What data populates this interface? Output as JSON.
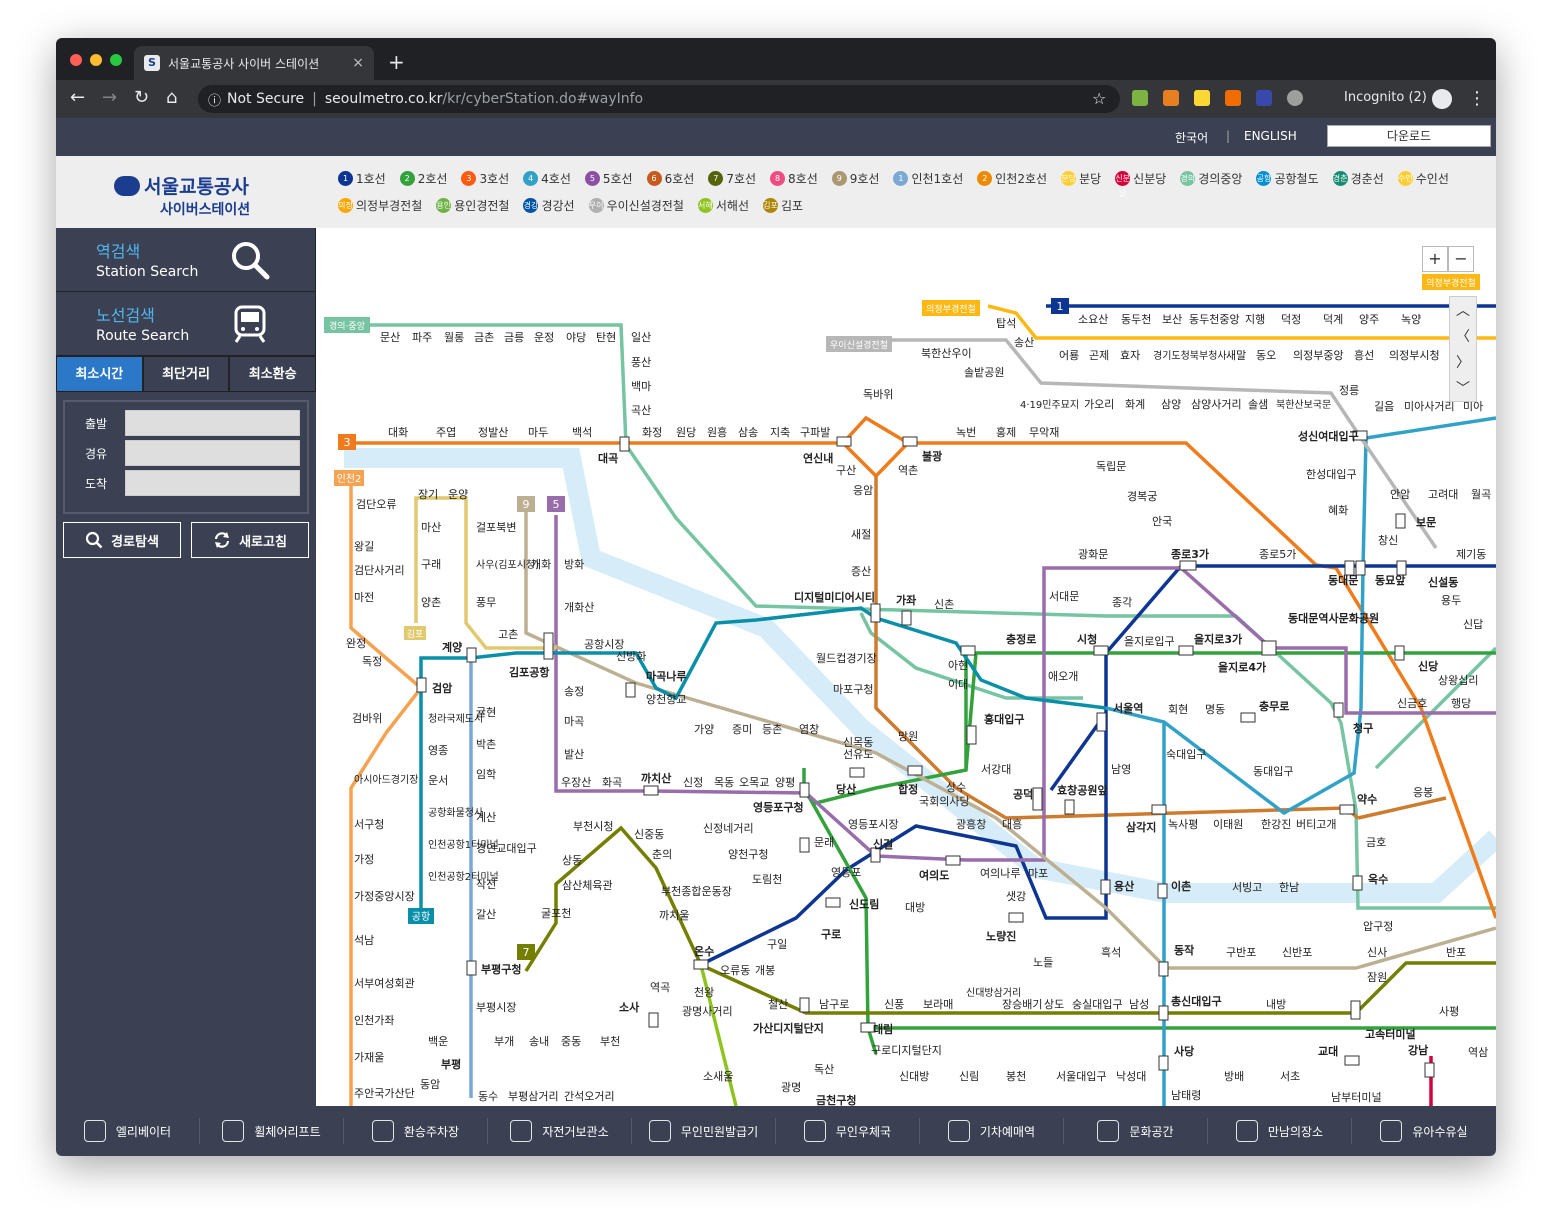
{
  "browser": {
    "tab_title": "서울교통공사 사이버 스테이션",
    "tab_close": "×",
    "new_tab": "+",
    "security": "Not Secure",
    "url_domain": "seoulmetro.co.kr",
    "url_path": "/kr/cyberStation.do#wayInfo",
    "incognito": "Incognito (2)"
  },
  "site": {
    "lang_ko": "한국어",
    "lang_en": "ENGLISH",
    "download": "다운로드",
    "logo_main": "서울교통공사",
    "logo_sub": "사이버스테이션"
  },
  "legend": [
    {
      "label": "1호선",
      "color": "#0d3692",
      "badge": "1"
    },
    {
      "label": "2호선",
      "color": "#33a23d",
      "badge": "2"
    },
    {
      "label": "3호선",
      "color": "#fe5b10",
      "badge": "3"
    },
    {
      "label": "4호선",
      "color": "#32a1c8",
      "badge": "4"
    },
    {
      "label": "5호선",
      "color": "#8b50a4",
      "badge": "5"
    },
    {
      "label": "6호선",
      "color": "#c55c1d",
      "badge": "6"
    },
    {
      "label": "7호선",
      "color": "#54640d",
      "badge": "7"
    },
    {
      "label": "8호선",
      "color": "#f14c82",
      "badge": "8"
    },
    {
      "label": "9호선",
      "color": "#aa9872",
      "badge": "9"
    },
    {
      "label": "인천1호선",
      "color": "#7ca8d5",
      "badge": "1"
    },
    {
      "label": "인천2호선",
      "color": "#ed8b00",
      "badge": "2"
    },
    {
      "label": "분당",
      "color": "#ffce33",
      "badge": "분당"
    },
    {
      "label": "신분당",
      "color": "#d4003b",
      "badge": "신분당"
    },
    {
      "label": "경의중앙",
      "color": "#77c4a3",
      "badge": "경의"
    },
    {
      "label": "공항철도",
      "color": "#0090d2",
      "badge": "공항"
    },
    {
      "label": "경춘선",
      "color": "#178c72",
      "badge": "경춘"
    },
    {
      "label": "수인선",
      "color": "#ffce33",
      "badge": "수인"
    },
    {
      "label": "의정부경전철",
      "color": "#fda600",
      "badge": "의정"
    },
    {
      "label": "용인경전철",
      "color": "#6fb245",
      "badge": "용인"
    },
    {
      "label": "경강선",
      "color": "#0054a6",
      "badge": "경강"
    },
    {
      "label": "우이신설경전철",
      "color": "#b0b0b0",
      "badge": "우이"
    },
    {
      "label": "서해선",
      "color": "#8fc31f",
      "badge": "서해"
    },
    {
      "label": "김포",
      "color": "#ad8605",
      "badge": "김포"
    }
  ],
  "sidebar": {
    "station_search_ko": "역검색",
    "station_search_en": "Station Search",
    "route_search_ko": "노선검색",
    "route_search_en": "Route Search",
    "tabs": [
      "최소시간",
      "최단거리",
      "최소환승"
    ],
    "departure": "출발",
    "via": "경유",
    "arrival": "도착",
    "search_btn": "경로탐색",
    "refresh_btn": "새로고침"
  },
  "map": {
    "zoom_in": "+",
    "zoom_out": "−",
    "line_badges": {
      "l1": "1",
      "l3": "3",
      "l5": "5",
      "l7": "7",
      "l9": "9",
      "incheon2": "인천2",
      "gyeongui": "경의·중앙",
      "ui": "우이신설경전철",
      "uijeongbu": "의정부경전철",
      "uijeongbu2": "의정부경전철",
      "gimpo": "김포",
      "airport": "공항"
    },
    "stations": {
      "s01": "문산",
      "s02": "파주",
      "s03": "월롱",
      "s04": "금촌",
      "s05": "금릉",
      "s06": "운정",
      "s07": "야당",
      "s08": "탄현",
      "s09": "일산",
      "s10": "풍산",
      "s11": "백마",
      "s12": "곡산",
      "s13": "대화",
      "s14": "주엽",
      "s15": "정발산",
      "s16": "마두",
      "s17": "백석",
      "s18": "대곡",
      "s19": "화정",
      "s20": "원당",
      "s21": "원흥",
      "s22": "삼송",
      "s23": "지축",
      "s24": "구파발",
      "s25": "연신내",
      "s26": "불광",
      "s27": "녹번",
      "s28": "홍제",
      "s29": "무악재",
      "s30": "독바위",
      "s31": "구산",
      "s32": "역촌",
      "s33": "응암",
      "s34": "새절",
      "s35": "증산",
      "s36": "디지털미디어시티",
      "s37": "독립문",
      "s38": "경복궁",
      "s39": "안국",
      "s40": "종로3가",
      "s41": "종로5가",
      "s42": "동대문",
      "s43": "동묘앞",
      "s44": "신설동",
      "s45": "제기동",
      "s46": "광화문",
      "s47": "서대문",
      "s48": "종각",
      "s49": "시청",
      "s50": "충정로",
      "s51": "을지로입구",
      "s52": "을지로3가",
      "s53": "을지로4가",
      "s54": "동대문역사문화공원",
      "s55": "서울역",
      "s56": "회현",
      "s57": "명동",
      "s58": "충무로",
      "s59": "동대입구",
      "s60": "약수",
      "s61": "청구",
      "s62": "신당",
      "s63": "보문",
      "s64": "창신",
      "s65": "혜화",
      "s66": "한성대입구",
      "s67": "성신여대입구",
      "s68": "가좌",
      "s69": "신촌",
      "s70": "아현",
      "s71": "이대",
      "s72": "홍대입구",
      "s73": "서강대",
      "s74": "공덕",
      "s75": "효창공원앞",
      "s76": "애오개",
      "s77": "월드컵경기장",
      "s78": "마포구청",
      "s79": "망원",
      "s80": "합정",
      "s81": "상수",
      "s82": "광흥창",
      "s83": "대흥",
      "s84": "당산",
      "s85": "국회의사당",
      "s86": "여의도",
      "s87": "여의나루",
      "s88": "마포",
      "s89": "신목동",
      "s90": "선유도",
      "s91": "영등포구청",
      "s92": "영등포시장",
      "s93": "신길",
      "s94": "문래",
      "s95": "영등포",
      "s96": "신도림",
      "s97": "대방",
      "s98": "노량진",
      "s99": "샛강",
      "s100": "남영",
      "s101": "숙대입구",
      "s102": "삼각지",
      "s103": "녹사평",
      "s104": "이태원",
      "s105": "한강진",
      "s106": "버티고개",
      "s107": "용산",
      "s108": "이촌",
      "s109": "서빙고",
      "s110": "한남",
      "s111": "옥수",
      "s112": "금호",
      "s113": "응봉",
      "s114": "가양",
      "s115": "증미",
      "s116": "등촌",
      "s117": "염창",
      "s118": "마곡나루",
      "s119": "양천향교",
      "s120": "김포공항",
      "s121": "공항시장",
      "s122": "신방화",
      "s123": "송정",
      "s124": "마곡",
      "s125": "발산",
      "s126": "우장산",
      "s127": "화곡",
      "s128": "까치산",
      "s129": "신정",
      "s130": "목동",
      "s131": "오목교",
      "s132": "양평",
      "s133": "신정네거리",
      "s134": "양천구청",
      "s135": "도림천",
      "s136": "개화",
      "s137": "방화",
      "s138": "개화산",
      "s139": "계양",
      "s140": "검암",
      "s141": "고촌",
      "s142": "장기",
      "s143": "운양",
      "s144": "마산",
      "s145": "구래",
      "s146": "양촌",
      "s147": "걸포북변",
      "s148": "사우(김포시청)",
      "s149": "풍무",
      "s150": "검단오류",
      "s151": "왕길",
      "s152": "검단사거리",
      "s153": "마전",
      "s154": "완정",
      "s155": "독정",
      "s156": "검바위",
      "s157": "아시아드경기장",
      "s158": "서구청",
      "s159": "가정",
      "s160": "가정중앙시장",
      "s161": "석남",
      "s162": "서부여성회관",
      "s163": "인천가좌",
      "s164": "가재울",
      "s165": "주안국가산단",
      "s166": "청라국제도시",
      "s167": "영종",
      "s168": "운서",
      "s169": "공항화물청사",
      "s170": "인천공항1터미널",
      "s171": "인천공항2터미널",
      "s172": "귤현",
      "s173": "박촌",
      "s174": "임학",
      "s175": "계산",
      "s176": "경인교대입구",
      "s177": "작전",
      "s178": "갈산",
      "s179": "부평구청",
      "s180": "부평시장",
      "s181": "부평",
      "s182": "동암",
      "s183": "백운",
      "s184": "부개",
      "s185": "송내",
      "s186": "중동",
      "s187": "부천",
      "s188": "동수",
      "s189": "부평삼거리",
      "s190": "간석오거리",
      "s191": "부천시청",
      "s192": "신중동",
      "s193": "춘의",
      "s194": "상동",
      "s195": "삼산체육관",
      "s196": "굴포천",
      "s197": "부천종합운동장",
      "s198": "까치울",
      "s199": "온수",
      "s200": "천왕",
      "s201": "광명사거리",
      "s202": "역곡",
      "s203": "소사",
      "s204": "소새울",
      "s205": "오류동",
      "s206": "개봉",
      "s207": "구일",
      "s208": "구로",
      "s209": "철산",
      "s210": "가산디지털단지",
      "s211": "남구로",
      "s212": "대림",
      "s213": "신풍",
      "s214": "보라매",
      "s215": "신대방삼거리",
      "s216": "장승배기",
      "s217": "상도",
      "s218": "숭실대입구",
      "s219": "남성",
      "s220": "총신대입구",
      "s221": "내방",
      "s222": "고속터미널",
      "s223": "구로디지털단지",
      "s224": "신대방",
      "s225": "신림",
      "s226": "봉천",
      "s227": "서울대입구",
      "s228": "낙성대",
      "s229": "사당",
      "s230": "방배",
      "s231": "서초",
      "s232": "교대",
      "s233": "강남",
      "s234": "남태령",
      "s235": "남부터미널",
      "s236": "독산",
      "s237": "광명",
      "s238": "금천구청",
      "s239": "흑석",
      "s240": "노들",
      "s241": "동작",
      "s242": "구반포",
      "s243": "신반포",
      "s244": "압구정",
      "s245": "신사",
      "s246": "잠원",
      "s247": "반포",
      "s248": "사평",
      "s249": "역삼",
      "s250": "탑석",
      "s251": "송산",
      "s252": "소요산",
      "s253": "동두천",
      "s254": "보산",
      "s255": "동두천중앙",
      "s256": "지행",
      "s257": "덕정",
      "s258": "덕계",
      "s259": "양주",
      "s260": "녹양",
      "s261": "어룡",
      "s262": "곤제",
      "s263": "효자",
      "s264": "경기도청북부청사",
      "s265": "새말",
      "s266": "동오",
      "s267": "의정부중앙",
      "s268": "흥선",
      "s269": "의정부시청",
      "s270": "북한산우이",
      "s271": "솔밭공원",
      "s272": "4·19민주묘지",
      "s273": "가오리",
      "s274": "화계",
      "s275": "삼양",
      "s276": "삼양사거리",
      "s277": "솔샘",
      "s278": "북한산보국문",
      "s279": "정릉",
      "s280": "길음",
      "s281": "미아사거리",
      "s282": "미아",
      "s283": "안암",
      "s284": "고려대",
      "s285": "월곡",
      "s286": "용두",
      "s287": "신답",
      "s288": "상왕십리",
      "s289": "신금호",
      "s290": "행당"
    }
  },
  "bottom": [
    {
      "label": "엘리베이터",
      "icon": "elevator-icon"
    },
    {
      "label": "휠체어리프트",
      "icon": "wheelchair-icon"
    },
    {
      "label": "환승주차장",
      "icon": "parking-icon"
    },
    {
      "label": "자전거보관소",
      "icon": "bicycle-icon"
    },
    {
      "label": "무인민원발급기",
      "icon": "kiosk-icon"
    },
    {
      "label": "무인우체국",
      "icon": "post-icon"
    },
    {
      "label": "기차예매역",
      "icon": "train-ticket-icon"
    },
    {
      "label": "문화공간",
      "icon": "culture-icon"
    },
    {
      "label": "만남의장소",
      "icon": "meeting-icon"
    },
    {
      "label": "유아수유실",
      "icon": "nursing-room-icon"
    }
  ]
}
